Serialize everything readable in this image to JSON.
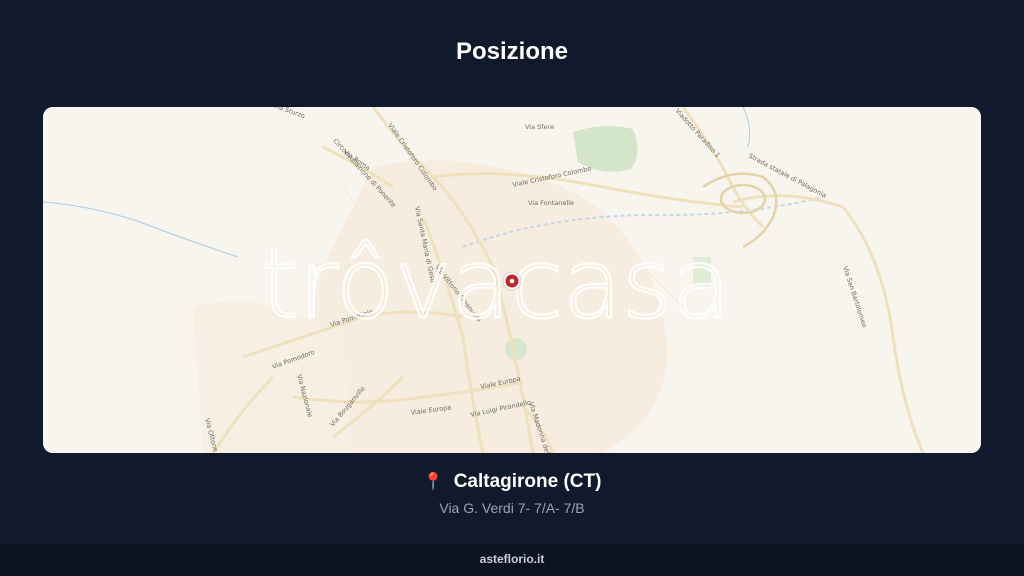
{
  "page": {
    "title": "Posizione"
  },
  "map": {
    "watermark": "trôvacasa",
    "labels": {
      "viale_cristoforo_colombo_1": "Viale Cristoforo Colombo",
      "viale_cristoforo_colombo_2": "Viale Cristoforo Colombo",
      "circonvallazione": "Circonvallazione di Ponente",
      "via_roma": "Via Roma",
      "via_fontanelle": "Via Fontanelle",
      "via_sfere": "Via Sfere",
      "viadotto": "Viadotto Paradiso 1",
      "strada_statale": "Strada statale di Palagonia",
      "via_san_bartolomeo": "Via San Bartolomeo",
      "via_santa_maria": "Via Santa Maria di Gesù",
      "via_vittorio_emanuele": "Via Vittorio Emanuele",
      "via_pomorinio": "Via Pomorinio",
      "via_pomodoro": "Via Pomodoro",
      "via_nazionale": "Via Nazionale",
      "via_bouganville": "Via Bouganville",
      "via_europa_1": "Viale Europa",
      "via_europa_2": "Viale Europa",
      "via_luigi": "Via Luigi Pirandello",
      "via_madonna": "Via Madonna della Via",
      "via_ottone": "Via Ottone di Bismarck",
      "via_sturzo": "Via Sturzo"
    }
  },
  "location": {
    "city": "Caltagirone (CT)",
    "address": "Via G. Verdi 7- 7/A- 7/B",
    "pin_color": "#c0262d"
  },
  "footer": {
    "site": "asteflorio.it"
  },
  "colors": {
    "background": "#101a2c",
    "map_bg": "#f8f4ee",
    "park": "#cfe3c6",
    "road": "#efe2c4",
    "pin": "#c0262d"
  }
}
